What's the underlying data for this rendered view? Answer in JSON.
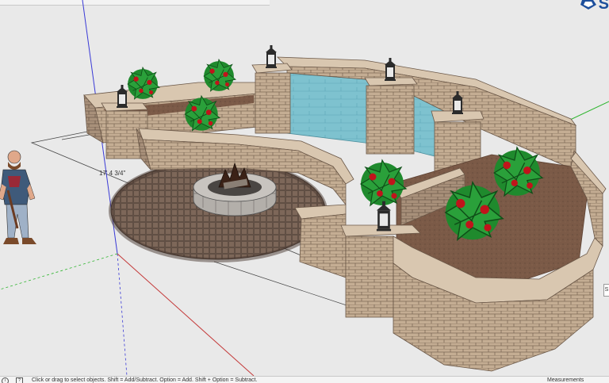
{
  "viewport": {
    "dimension_label": "17' 4 3/4\"",
    "side_marker": "S"
  },
  "logo": {
    "icon": "sketchup-logo-icon",
    "text": "S"
  },
  "statusbar": {
    "info_icon": "info-icon",
    "help_icon": "help-icon",
    "info_glyph": "i",
    "help_glyph": "?",
    "status_text": "Click or drag to select objects. Shift = Add/Subtract. Option = Add. Shift + Option = Subtract.",
    "measurements_label": "Measurements"
  },
  "colors": {
    "stone_light": "#c9b39a",
    "stone_dark": "#8a735c",
    "cap": "#d9c7b0",
    "water": "#7ec2cf",
    "mulch": "#7b5a47",
    "paver": "#6b574c",
    "foliage": "#1f8a2d",
    "flower": "#c0141b",
    "axis_blue": "#3a3ad6",
    "axis_green": "#2fb52f",
    "axis_red": "#c43a3a"
  }
}
